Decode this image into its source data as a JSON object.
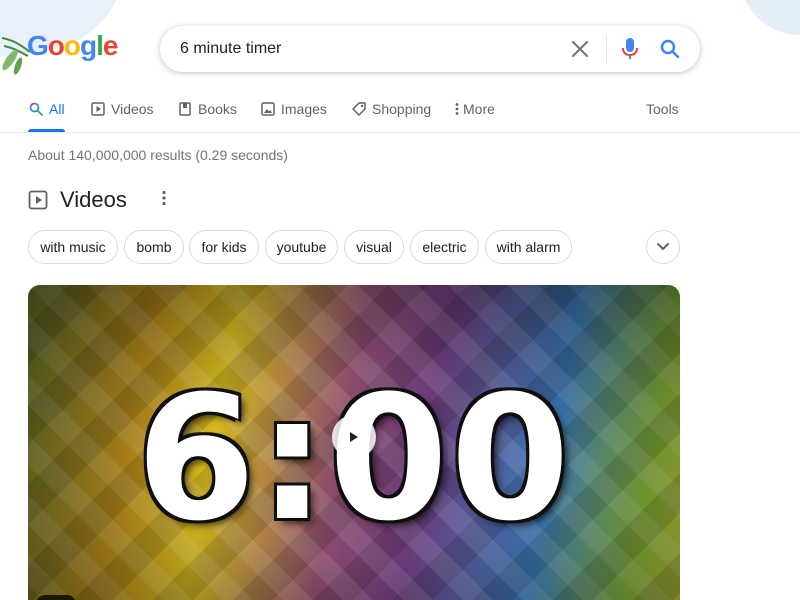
{
  "logo": {
    "text": [
      "G",
      "o",
      "o",
      "g",
      "l",
      "e"
    ]
  },
  "search": {
    "query": "6 minute timer",
    "clear_icon": "close-icon",
    "voice_icon": "microphone-icon",
    "search_icon": "search-icon"
  },
  "tabs": {
    "items": [
      {
        "label": "All",
        "icon": "search-icon",
        "active": true
      },
      {
        "label": "Videos",
        "icon": "play-box-icon",
        "active": false
      },
      {
        "label": "Books",
        "icon": "book-icon",
        "active": false
      },
      {
        "label": "Images",
        "icon": "image-icon",
        "active": false
      },
      {
        "label": "Shopping",
        "icon": "tag-icon",
        "active": false
      },
      {
        "label": "More",
        "icon": "vertical-dots-icon",
        "active": false
      }
    ],
    "tools_label": "Tools"
  },
  "result_stats": "About 140,000,000 results (0.29 seconds)",
  "videos": {
    "title": "Videos",
    "chips": [
      "with music",
      "bomb",
      "for kids",
      "youtube",
      "visual",
      "electric",
      "with alarm"
    ],
    "thumbnail": {
      "text": "6:00"
    }
  },
  "colors": {
    "accent": "#1a73e8",
    "text_secondary": "#5f6368",
    "stats_text": "#70757a",
    "border": "#dadce0"
  }
}
